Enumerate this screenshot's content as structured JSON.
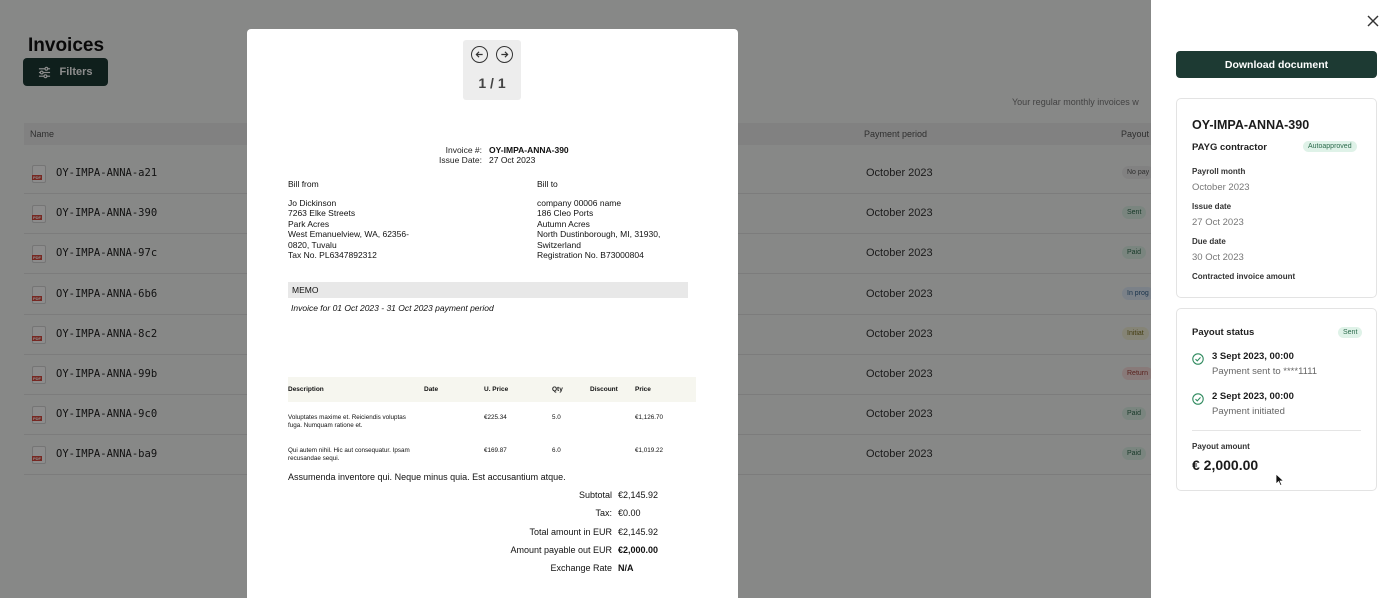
{
  "page": {
    "title": "Invoices",
    "filters_label": "Filters",
    "helper_note": "Your regular monthly invoices w",
    "columns": {
      "name": "Name",
      "period": "Payment period",
      "payout": "Payout"
    },
    "rows": [
      {
        "name": "OY-IMPA-ANNA-a21",
        "period": "October 2023",
        "status": "No pay"
      },
      {
        "name": "OY-IMPA-ANNA-390",
        "period": "October 2023",
        "status": "Sent"
      },
      {
        "name": "OY-IMPA-ANNA-97c",
        "period": "October 2023",
        "status": "Paid"
      },
      {
        "name": "OY-IMPA-ANNA-6b6",
        "period": "October 2023",
        "status": "In prog"
      },
      {
        "name": "OY-IMPA-ANNA-8c2",
        "period": "October 2023",
        "status": "Initiat"
      },
      {
        "name": "OY-IMPA-ANNA-99b",
        "period": "October 2023",
        "status": "Return"
      },
      {
        "name": "OY-IMPA-ANNA-9c0",
        "period": "October 2023",
        "status": "Paid"
      },
      {
        "name": "OY-IMPA-ANNA-ba9",
        "period": "October 2023",
        "status": "Paid"
      }
    ]
  },
  "viewer": {
    "page_indicator": "1 / 1",
    "invoice_number_label": "Invoice #:",
    "invoice_number": "OY-IMPA-ANNA-390",
    "issue_date_label": "Issue Date:",
    "issue_date": "27 Oct 2023",
    "bill_from_title": "Bill from",
    "bill_from": [
      "Jo Dickinson",
      "7263 Elke Streets",
      "Park Acres",
      "West Emanuelview, WA, 62356-",
      "0820, Tuvalu",
      "Tax No. PL6347892312"
    ],
    "bill_to_title": "Bill to",
    "bill_to": [
      "company 00006 name",
      "186 Cleo Ports",
      "Autumn Acres",
      "North Dustinborough, MI, 31930,",
      "Switzerland",
      "Registration No. B73000804"
    ],
    "memo_title": "MEMO",
    "memo_text": "Invoice for 01 Oct 2023 - 31 Oct 2023 payment period",
    "item_headers": {
      "description": "Description",
      "date": "Date",
      "unit_price": "U. Price",
      "qty": "Qty",
      "discount": "Discount",
      "price": "Price"
    },
    "items": [
      {
        "description": "Voluptates maxime et. Reiciendis voluptas fuga. Numquam ratione et.",
        "unit_price": "€225.34",
        "qty": "5.0",
        "price": "€1,126.70"
      },
      {
        "description": "Qui autem nihil. Hic aut consequatur. Ipsam recusandae sequi.",
        "unit_price": "€169.87",
        "qty": "6.0",
        "price": "€1,019.22"
      }
    ],
    "extra_text": "Assumenda inventore qui. Neque minus quia. Est accusantium atque.",
    "totals": [
      {
        "label": "Subtotal",
        "value": "€2,145.92",
        "bold": false
      },
      {
        "label": "Tax:",
        "value": "€0.00",
        "bold": false
      },
      {
        "label": "Total amount in EUR",
        "value": "€2,145.92",
        "bold": false
      },
      {
        "label": "Amount payable out EUR",
        "value": "€2,000.00",
        "bold": true
      },
      {
        "label": "Exchange Rate",
        "value": "N/A",
        "bold": true
      }
    ]
  },
  "panel": {
    "download_label": "Download document",
    "invoice_id": "OY-IMPA-ANNA-390",
    "contract_type": "PAYG contractor",
    "approval_badge": "Autoapproved",
    "fields": [
      {
        "label": "Payroll month",
        "value": "October 2023"
      },
      {
        "label": "Issue date",
        "value": "27 Oct 2023"
      },
      {
        "label": "Due date",
        "value": "30 Oct 2023"
      },
      {
        "label": "Contracted invoice amount",
        "value": ""
      }
    ],
    "payout_status_title": "Payout status",
    "payout_status_badge": "Sent",
    "events": [
      {
        "title": "3 Sept 2023, 00:00",
        "subtitle": "Payment sent to ****1111"
      },
      {
        "title": "2 Sept 2023, 00:00",
        "subtitle": "Payment initiated"
      }
    ],
    "payout_amount_label": "Payout amount",
    "payout_amount": "€ 2,000.00"
  },
  "colors": {
    "accent": "#1d3a33",
    "success": "#2f8a5e",
    "badge_bg": "#dff2e8",
    "overlay": "rgba(0,0,0,0.45)"
  },
  "icons": [
    "filters-icon",
    "pdf-file-icon",
    "arrow-left-icon",
    "arrow-right-icon",
    "close-icon",
    "check-circle-icon",
    "cursor-icon"
  ]
}
